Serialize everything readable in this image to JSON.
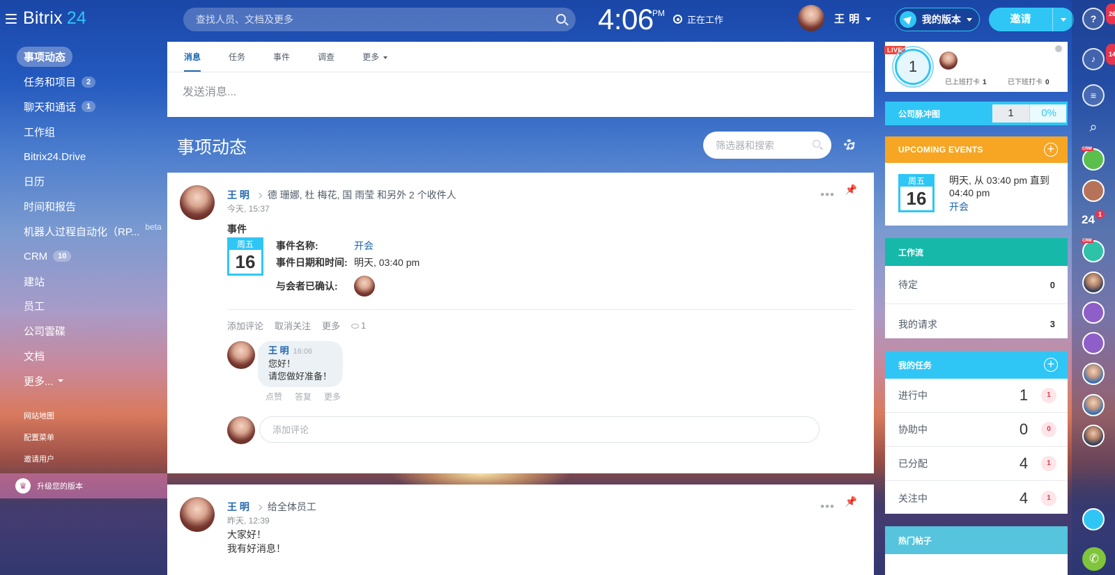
{
  "header": {
    "logo_main": "Bitrix",
    "logo_num": "24",
    "search_placeholder": "查找人员、文档及更多",
    "clock": "4:06",
    "ampm": "PM",
    "work_status": "正在工作",
    "user_name": "王 明",
    "plan_label": "我的版本",
    "invite_label": "邀请"
  },
  "left_menu": {
    "items": [
      {
        "label": "事项动态",
        "count": ""
      },
      {
        "label": "任务和项目",
        "count": "2"
      },
      {
        "label": "聊天和通话",
        "count": "1"
      },
      {
        "label": "工作组",
        "count": ""
      },
      {
        "label": "Bitrix24.Drive",
        "count": ""
      },
      {
        "label": "日历",
        "count": ""
      },
      {
        "label": "时间和报告",
        "count": ""
      },
      {
        "label": "机器人过程自动化（RP...",
        "count": "",
        "tag": "beta"
      },
      {
        "label": "CRM",
        "count": "10"
      },
      {
        "label": "建站",
        "count": ""
      },
      {
        "label": "员工",
        "count": ""
      },
      {
        "label": "公司雲碟",
        "count": ""
      },
      {
        "label": "文档",
        "count": ""
      },
      {
        "label": "更多...",
        "count": ""
      }
    ],
    "sitemap": "网站地图",
    "configure": "配置菜单",
    "invite_users": "邀请用户",
    "upgrade": "升级您的版本"
  },
  "composer": {
    "tabs": [
      "消息",
      "任务",
      "事件",
      "调查",
      "更多"
    ],
    "placeholder": "发送消息..."
  },
  "feed": {
    "title": "事项动态",
    "filter_placeholder": "筛选器和搜索"
  },
  "post1": {
    "author": "王 明",
    "recipients": "德 珊娜, 杜 梅花, 国 雨莹   和另外 2 个收件人",
    "time": "今天, 15:37",
    "type": "事件",
    "cal_day": "周五",
    "cal_num": "16",
    "name_label": "事件名称:",
    "name_value": "开会",
    "date_label": "事件日期和时间:",
    "date_value": "明天, 03:40 pm",
    "attendees_label": "与会者已确认:",
    "actions": [
      "添加评论",
      "取消关注",
      "更多"
    ],
    "views": "1",
    "comment": {
      "author": "王 明",
      "time": "16:06",
      "line1": "您好！",
      "line2": "请您做好准备！",
      "actions": [
        "点赞",
        "答复",
        "更多"
      ]
    },
    "add_comment_placeholder": "添加评论"
  },
  "post2": {
    "author": "王 明",
    "recipients": "给全体员工",
    "time": "昨天, 12:39",
    "line1": "大家好！",
    "line2": "我有好消息！"
  },
  "right": {
    "live": "LIVE",
    "timeman_count": "1",
    "checked_in_label": "已上班打卡",
    "checked_in": "1",
    "checked_out_label": "已下班打卡",
    "checked_out": "0",
    "pulse_label": "公司脉冲图",
    "pulse_value": "1",
    "pulse_percent": "0%",
    "events_title": "UPCOMING EVENTS",
    "event_day": "周五",
    "event_num": "16",
    "event_when": "明天, 从 03:40 pm 直到 04:40 pm",
    "event_name": "开会",
    "workflow_title": "工作流",
    "workflow_rows": [
      {
        "label": "待定",
        "value": "0"
      },
      {
        "label": "我的请求",
        "value": "3"
      }
    ],
    "tasks_title": "我的任务",
    "tasks_rows": [
      {
        "label": "进行中",
        "value": "1",
        "badge": "1"
      },
      {
        "label": "协助中",
        "value": "0",
        "badge": "0"
      },
      {
        "label": "已分配",
        "value": "4",
        "badge": "1"
      },
      {
        "label": "关注中",
        "value": "4",
        "badge": "1"
      }
    ],
    "hot_title": "热门帖子"
  },
  "rail": {
    "help_badge": "26",
    "notify_badge": "14",
    "crm_tag": "CRM",
    "b24": "24",
    "b24_badge": "1"
  }
}
